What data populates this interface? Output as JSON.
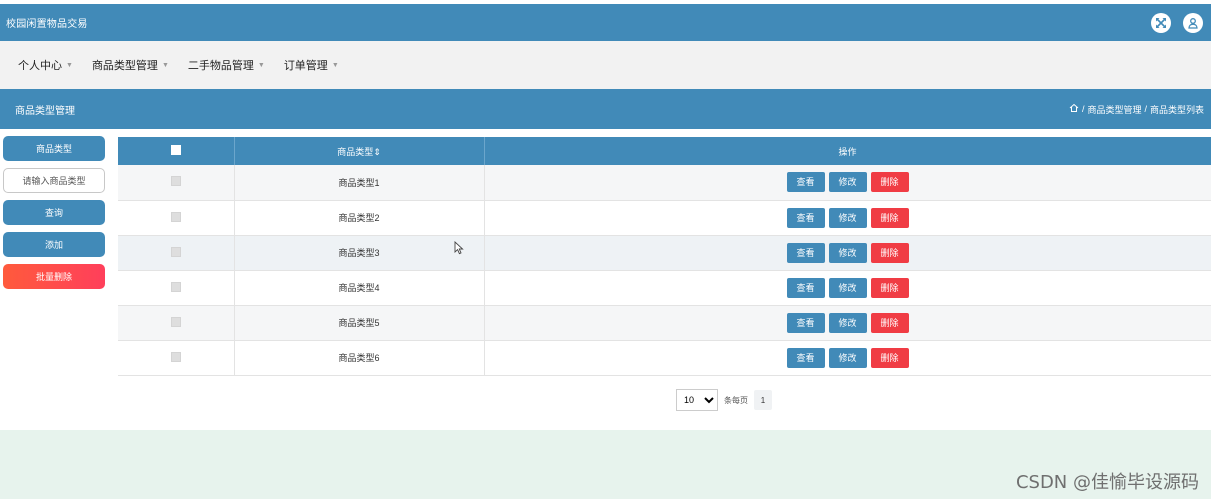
{
  "header": {
    "title": "校园闲置物品交易",
    "icons": [
      "fullscreen-icon",
      "user-icon"
    ]
  },
  "nav": {
    "items": [
      {
        "label": "个人中心"
      },
      {
        "label": "商品类型管理"
      },
      {
        "label": "二手物品管理"
      },
      {
        "label": "订单管理"
      }
    ]
  },
  "page": {
    "title": "商品类型管理",
    "breadcrumb": {
      "sep1": "/",
      "item1": "商品类型管理",
      "sep2": "/",
      "item2": "商品类型列表"
    }
  },
  "sidebar": {
    "field_label": "商品类型",
    "search_placeholder": "请输入商品类型",
    "search_button": "查询",
    "add_button": "添加",
    "batch_delete_button": "批量删除"
  },
  "table": {
    "headers": {
      "name": "商品类型",
      "sort_glyph": "⇕",
      "actions": "操作"
    },
    "rows": [
      {
        "name": "商品类型1"
      },
      {
        "name": "商品类型2"
      },
      {
        "name": "商品类型3"
      },
      {
        "name": "商品类型4"
      },
      {
        "name": "商品类型5"
      },
      {
        "name": "商品类型6"
      }
    ],
    "actions": {
      "view": "查看",
      "edit": "修改",
      "delete": "删除"
    }
  },
  "pagination": {
    "page_size": "10",
    "per_page_label": "条每页",
    "current_page": "1"
  },
  "watermark": "CSDN @佳愉毕设源码",
  "colors": {
    "primary": "#418ab8",
    "danger": "#f03c44",
    "footer": "#e7f3ed"
  }
}
